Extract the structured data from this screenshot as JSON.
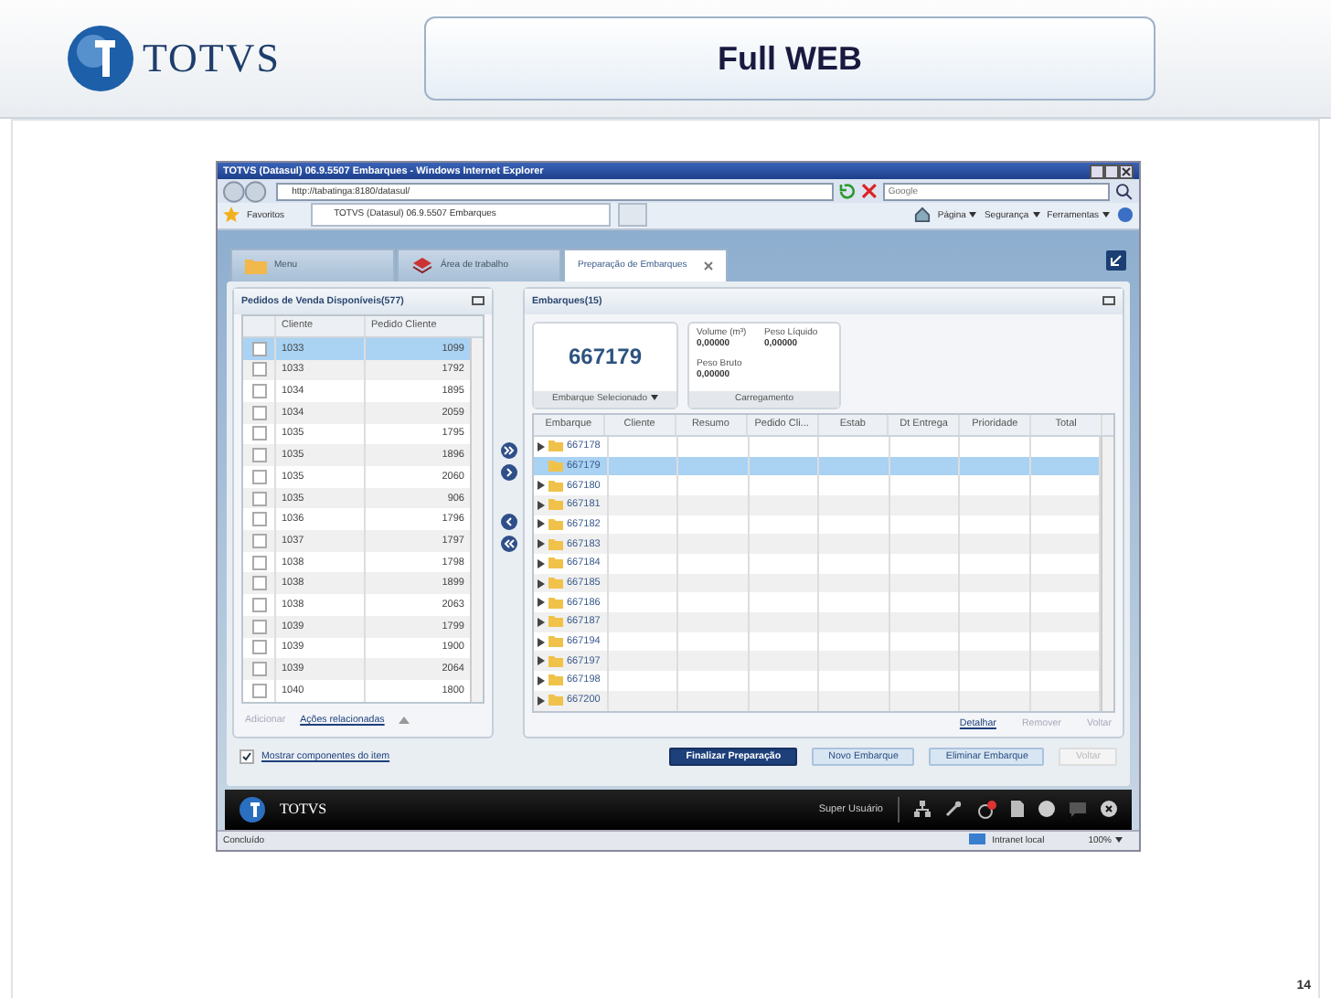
{
  "slide": {
    "logo_text": "TOTVS",
    "title": "Full WEB",
    "page_number": "14"
  },
  "browser": {
    "title": "TOTVS (Datasul) 06.9.5507 Embarques - Windows Internet Explorer",
    "url": "http://tabatinga:8180/datasul/",
    "search": {
      "placeholder": "Google"
    },
    "favorites": "Favoritos",
    "tab": "TOTVS (Datasul) 06.9.5507 Embarques",
    "commands": [
      "Página",
      "Segurança",
      "Ferramentas"
    ]
  },
  "app_tabs": [
    {
      "label": "Menu",
      "kind": "folder",
      "selected": false,
      "closable": false
    },
    {
      "label": "Área de trabalho",
      "kind": "desk",
      "selected": false,
      "closable": false
    },
    {
      "label": "Preparação de Embarques",
      "kind": "plain",
      "selected": true,
      "closable": true
    }
  ],
  "left_panel": {
    "title": "Pedidos de Venda Disponíveis(577)",
    "columns": [
      "Cliente",
      "Pedido Cliente"
    ],
    "rows": [
      {
        "cliente": "1033",
        "pedido": "1099",
        "selected": true,
        "checked": false
      },
      {
        "cliente": "1033",
        "pedido": "1792",
        "selected": false,
        "checked": false
      },
      {
        "cliente": "1034",
        "pedido": "1895",
        "selected": false,
        "checked": false
      },
      {
        "cliente": "1034",
        "pedido": "2059",
        "selected": false,
        "checked": false
      },
      {
        "cliente": "1035",
        "pedido": "1795",
        "selected": false,
        "checked": false
      },
      {
        "cliente": "1035",
        "pedido": "1896",
        "selected": false,
        "checked": false
      },
      {
        "cliente": "1035",
        "pedido": "2060",
        "selected": false,
        "checked": false
      },
      {
        "cliente": "1035",
        "pedido": "906",
        "selected": false,
        "checked": false
      },
      {
        "cliente": "1036",
        "pedido": "1796",
        "selected": false,
        "checked": false
      },
      {
        "cliente": "1037",
        "pedido": "1797",
        "selected": false,
        "checked": false
      },
      {
        "cliente": "1038",
        "pedido": "1798",
        "selected": false,
        "checked": false
      },
      {
        "cliente": "1038",
        "pedido": "1899",
        "selected": false,
        "checked": false
      },
      {
        "cliente": "1038",
        "pedido": "2063",
        "selected": false,
        "checked": false
      },
      {
        "cliente": "1039",
        "pedido": "1799",
        "selected": false,
        "checked": false
      },
      {
        "cliente": "1039",
        "pedido": "1900",
        "selected": false,
        "checked": false
      },
      {
        "cliente": "1039",
        "pedido": "2064",
        "selected": false,
        "checked": false
      },
      {
        "cliente": "1040",
        "pedido": "1800",
        "selected": false,
        "checked": false
      }
    ],
    "actions": [
      {
        "label": "Adicionar",
        "disabled": true
      },
      {
        "label": "Ações relacionadas",
        "disabled": false
      }
    ]
  },
  "right_panel": {
    "title": "Embarques(15)",
    "selected_shipment": {
      "value": "667179",
      "label": "Embarque Selecionado"
    },
    "loading": {
      "label": "Carregamento",
      "fields": [
        {
          "label": "Volume (m³)",
          "value": "0,00000"
        },
        {
          "label": "Peso Líquido",
          "value": "0,00000"
        },
        {
          "label": "Peso Bruto",
          "value": "0,00000"
        }
      ]
    },
    "columns": [
      "Embarque",
      "Cliente",
      "Resumo",
      "Pedido Cli...",
      "Estab",
      "Dt Entrega",
      "Prioridade",
      "Total"
    ],
    "rows": [
      {
        "id": "667178",
        "selected": false,
        "expandable": true
      },
      {
        "id": "667179",
        "selected": true,
        "expandable": false
      },
      {
        "id": "667180",
        "selected": false,
        "expandable": true
      },
      {
        "id": "667181",
        "selected": false,
        "expandable": true
      },
      {
        "id": "667182",
        "selected": false,
        "expandable": true
      },
      {
        "id": "667183",
        "selected": false,
        "expandable": true
      },
      {
        "id": "667184",
        "selected": false,
        "expandable": true
      },
      {
        "id": "667185",
        "selected": false,
        "expandable": true
      },
      {
        "id": "667186",
        "selected": false,
        "expandable": true
      },
      {
        "id": "667187",
        "selected": false,
        "expandable": true
      },
      {
        "id": "667194",
        "selected": false,
        "expandable": true
      },
      {
        "id": "667197",
        "selected": false,
        "expandable": true
      },
      {
        "id": "667198",
        "selected": false,
        "expandable": true
      },
      {
        "id": "667200",
        "selected": false,
        "expandable": true
      }
    ],
    "actions": [
      {
        "label": "Detalhar",
        "disabled": false
      },
      {
        "label": "Remover",
        "disabled": true
      },
      {
        "label": "Voltar",
        "disabled": true
      }
    ]
  },
  "show_components": {
    "label": "Mostrar componentes do item",
    "checked": true
  },
  "buttons": [
    {
      "label": "Finalizar Preparação",
      "kind": "primary",
      "disabled": false
    },
    {
      "label": "Novo Embarque",
      "kind": "secondary",
      "disabled": false
    },
    {
      "label": "Eliminar Embarque",
      "kind": "secondary",
      "disabled": false
    },
    {
      "label": "Voltar",
      "kind": "secondary",
      "disabled": true
    }
  ],
  "taskbar": {
    "logo_text": "TOTVS",
    "user": "Super Usuário"
  },
  "status_bar": {
    "status": "Concluído",
    "zone": "Intranet local",
    "zoom": "100%"
  }
}
